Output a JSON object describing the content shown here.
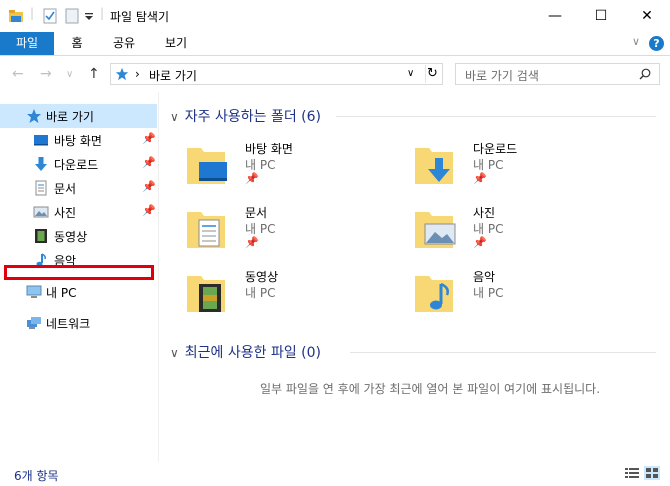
{
  "window": {
    "title": "파일 탐색기",
    "minimize_glyph": "—",
    "maximize_glyph": "☐",
    "close_glyph": "✕"
  },
  "ribbon": {
    "tabs": [
      "파일",
      "홈",
      "공유",
      "보기"
    ],
    "help_glyph": "?",
    "collapse_glyph": "∨"
  },
  "navbar": {
    "back_glyph": "←",
    "forward_glyph": "→",
    "recent_glyph": "∨",
    "up_glyph": "↑",
    "address_text": "바로 가기",
    "address_sep": "›",
    "search_placeholder": "바로 가기 검색"
  },
  "navpane": {
    "quick_access": "바로 가기",
    "items": [
      {
        "label": "바탕 화면",
        "pinned": true,
        "icon": "desktop-icon"
      },
      {
        "label": "다운로드",
        "pinned": true,
        "icon": "download-icon"
      },
      {
        "label": "문서",
        "pinned": true,
        "icon": "document-icon"
      },
      {
        "label": "사진",
        "pinned": true,
        "icon": "picture-icon"
      },
      {
        "label": "동영상",
        "pinned": false,
        "icon": "video-icon"
      },
      {
        "label": "음악",
        "pinned": false,
        "icon": "music-icon"
      }
    ],
    "this_pc": "내 PC",
    "network": "네트워크"
  },
  "main": {
    "frequent_header": "자주 사용하는 폴더 (6)",
    "recent_header": "최근에 사용한 파일 (0)",
    "location": "내 PC",
    "folders": [
      {
        "name": "바탕 화면",
        "pinned": true
      },
      {
        "name": "다운로드",
        "pinned": true
      },
      {
        "name": "문서",
        "pinned": true
      },
      {
        "name": "사진",
        "pinned": true
      },
      {
        "name": "동영상",
        "pinned": false
      },
      {
        "name": "음악",
        "pinned": false
      }
    ],
    "empty_message": "일부 파일을 연 후에 가장 최근에 열어 본 파일이 여기에 표시됩니다."
  },
  "statusbar": {
    "count_text": "6개 항목"
  },
  "colors": {
    "accent": "#1979ca",
    "header_text": "#1e3287",
    "highlight_box": "#e0000b",
    "folder_yellow": "#f8d775"
  }
}
